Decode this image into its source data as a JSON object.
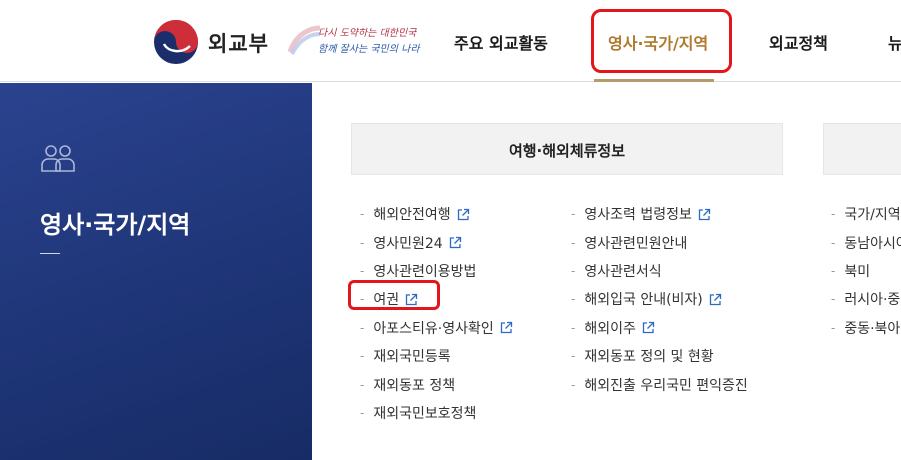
{
  "header": {
    "org_name": "외교부",
    "slogan_line1": "다시 도약하는 대한민국",
    "slogan_line2": "함께 잘사는 국민의 나라",
    "nav": [
      "주요 외교활동",
      "영사·국가/지역",
      "외교정책",
      "뉴"
    ]
  },
  "side": {
    "title": "영사·국가/지역"
  },
  "section": {
    "heading": "여행·해외체류정보"
  },
  "columns": {
    "col1": [
      {
        "label": "해외안전여행",
        "external": true
      },
      {
        "label": "영사민원24",
        "external": true
      },
      {
        "label": "영사관련이용방법",
        "external": false
      },
      {
        "label": "여권",
        "external": true
      },
      {
        "label": "아포스티유·영사확인",
        "external": true
      },
      {
        "label": "재외국민등록",
        "external": false
      },
      {
        "label": "재외동포 정책",
        "external": false
      },
      {
        "label": "재외국민보호정책",
        "external": false
      }
    ],
    "col2": [
      {
        "label": "영사조력 법령정보",
        "external": true
      },
      {
        "label": "영사관련민원안내",
        "external": false
      },
      {
        "label": "영사관련서식",
        "external": false
      },
      {
        "label": "해외입국 안내(비자)",
        "external": true
      },
      {
        "label": "해외이주",
        "external": true
      },
      {
        "label": "재외동포 정의 및 현황",
        "external": false
      },
      {
        "label": "해외진출 우리국민 편익증진",
        "external": false
      }
    ],
    "col3": [
      {
        "label": "국가/지역",
        "external": false
      },
      {
        "label": "동남아시아",
        "external": false
      },
      {
        "label": "북미",
        "external": false
      },
      {
        "label": "러시아·중",
        "external": false
      },
      {
        "label": "중동·북아",
        "external": false
      }
    ]
  },
  "colors": {
    "accent_gold": "#b07a2e",
    "side_bg": "#1e3577",
    "highlight_red": "#e3161b"
  }
}
